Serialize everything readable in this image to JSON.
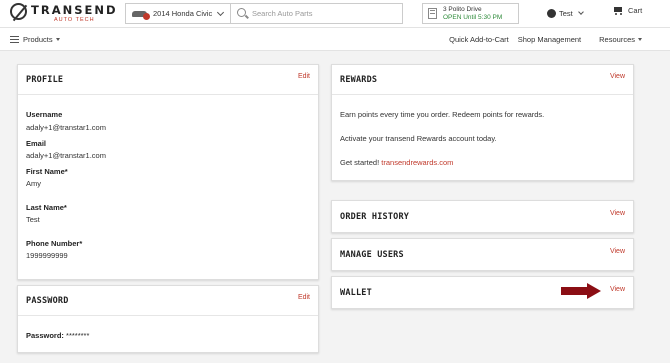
{
  "header": {
    "logo_text": "TRANSEND",
    "logo_sub": "AUTO TECH",
    "vehicle": "2014 Honda Civic",
    "search_placeholder": "Search Auto Parts",
    "store_name": "3 Polito Drive",
    "store_hours": "OPEN Until 5:30 PM",
    "user_name": "Test",
    "cart_label": "Cart"
  },
  "nav": {
    "products_label": "Products",
    "quick_add": "Quick Add-to-Cart",
    "shop_management": "Shop Management",
    "resources": "Resources"
  },
  "profile": {
    "title": "PROFILE",
    "edit_label": "Edit",
    "username_label": "Username",
    "username_value": "adaly+1@transtar1.com",
    "email_label": "Email",
    "email_value": "adaly+1@transtar1.com",
    "first_name_label": "First Name*",
    "first_name_value": "Amy",
    "last_name_label": "Last Name*",
    "last_name_value": "Test",
    "phone_label": "Phone Number*",
    "phone_value": "1999999999"
  },
  "password": {
    "title": "PASSWORD",
    "edit_label": "Edit",
    "label": "Password:",
    "value": "********"
  },
  "rewards": {
    "title": "REWARDS",
    "view_label": "View",
    "line1": "Earn points every time you order. Redeem points for rewards.",
    "line2": "Activate your transend Rewards account today.",
    "line3_prefix": "Get started!",
    "line3_link": "transendrewards.com"
  },
  "order_history": {
    "title": "ORDER HISTORY",
    "view_label": "View"
  },
  "manage_users": {
    "title": "MANAGE USERS",
    "view_label": "View"
  },
  "wallet": {
    "title": "WALLET",
    "view_label": "View"
  },
  "colors": {
    "accent": "#c0392b",
    "arrow": "#8b0e14",
    "open": "#2e8b3a"
  }
}
